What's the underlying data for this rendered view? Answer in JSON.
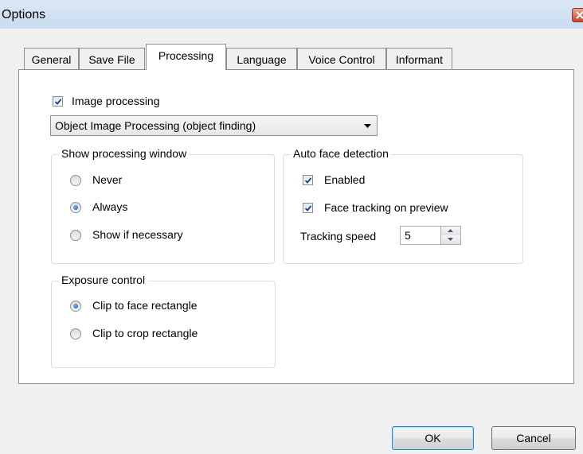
{
  "window": {
    "title": "Options"
  },
  "tabs": [
    {
      "label": "General"
    },
    {
      "label": "Save File"
    },
    {
      "label": "Processing"
    },
    {
      "label": "Language"
    },
    {
      "label": "Voice Control"
    },
    {
      "label": "Informant"
    }
  ],
  "active_tab": "Processing",
  "image_processing": {
    "label": "Image processing",
    "checked": true,
    "method_selected": "Object Image Processing (object finding)"
  },
  "show_processing_window": {
    "legend": "Show processing window",
    "options": [
      {
        "label": "Never",
        "selected": false
      },
      {
        "label": "Always",
        "selected": true
      },
      {
        "label": "Show if necessary",
        "selected": false
      }
    ]
  },
  "auto_face_detection": {
    "legend": "Auto face detection",
    "enabled_label": "Enabled",
    "enabled_checked": true,
    "tracking_preview_label": "Face tracking on preview",
    "tracking_preview_checked": true,
    "speed_label": "Tracking speed",
    "speed_value": "5"
  },
  "exposure_control": {
    "legend": "Exposure control",
    "options": [
      {
        "label": "Clip to face rectangle",
        "selected": true
      },
      {
        "label": "Clip to crop rectangle",
        "selected": false
      }
    ]
  },
  "buttons": {
    "ok": "OK",
    "cancel": "Cancel"
  }
}
